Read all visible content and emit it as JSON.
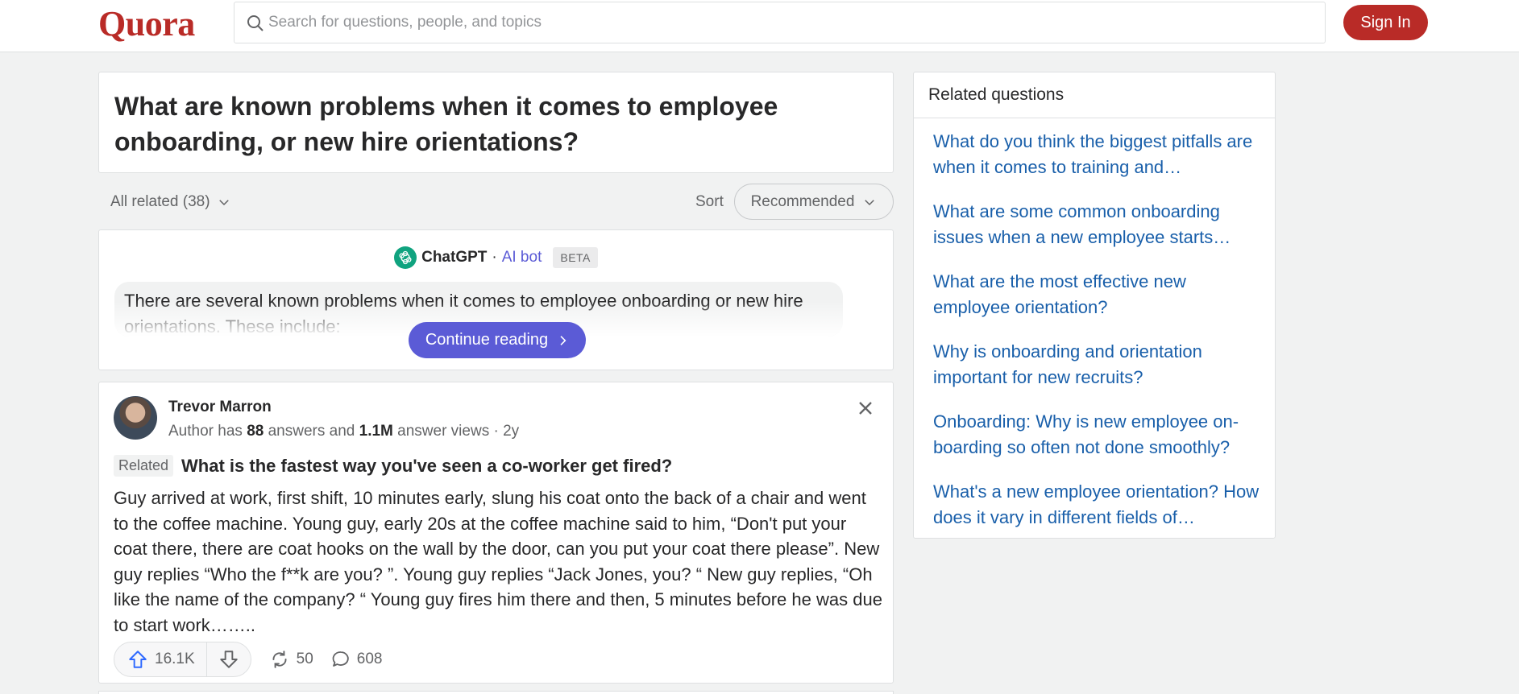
{
  "header": {
    "logo": "Quora",
    "search_placeholder": "Search for questions, people, and topics",
    "signin_label": "Sign In"
  },
  "question": {
    "title": "What are known problems when it comes to employee onboarding, or new hire orientations?"
  },
  "filters": {
    "all_related": "All related (38)",
    "sort_label": "Sort",
    "sort_value": "Recommended"
  },
  "chatgpt": {
    "name": "ChatGPT",
    "separator": "·",
    "bot_label": "AI bot",
    "badge": "BETA",
    "text": "There are several known problems when it comes to employee onboarding or new hire orientations. These include:",
    "continue_label": "Continue reading"
  },
  "answer": {
    "author": "Trevor Marron",
    "cred_prefix": "Author has",
    "answers_count": "88",
    "cred_mid": "answers and",
    "views_count": "1.1M",
    "cred_suffix": "answer views · 2y",
    "related_tag": "Related",
    "related_question": "What is the fastest way you've seen a co-worker get fired?",
    "body": "Guy arrived at work, first shift, 10 minutes early, slung his coat onto the back of a chair and went to the coffee machine. Young guy, early 20s at the coffee machine said to him, “Don't put your coat there, there are coat hooks on the wall by the door, can you put your coat there please”. New guy replies “Who the f**k are you? ”. Young guy replies “Jack Jones, you? “ New guy replies, “Oh like the name of the company? “ Young guy fires him there and then, 5 minutes before he was due to start work……..",
    "upvotes": "16.1K",
    "shares": "50",
    "comments": "608"
  },
  "sidebar": {
    "title": "Related questions",
    "items": [
      {
        "label": "What do you think the biggest pitfalls are when it comes to training and…"
      },
      {
        "label": "What are some common onboarding issues when a new employee starts…"
      },
      {
        "label": "What are the most effective new employee orientation?"
      },
      {
        "label": "Why is onboarding and orientation important for new recruits?"
      },
      {
        "label": "Onboarding: Why is new employee on-boarding so often not done smoothly?"
      },
      {
        "label": "What's a new employee orientation? How does it vary in different fields of…"
      }
    ]
  },
  "colors": {
    "brand": "#b92b27",
    "bot_accent": "#5b5bd6",
    "link": "#195faa",
    "background": "#f1f2f2"
  }
}
